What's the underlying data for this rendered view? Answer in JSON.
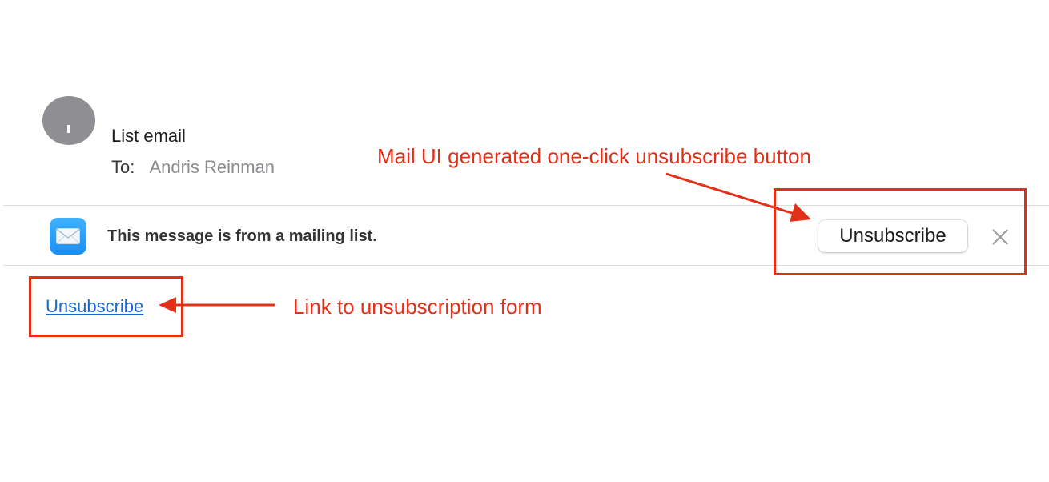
{
  "header": {
    "subject": "List email",
    "to_label": "To:",
    "to_name": "Andris Reinman"
  },
  "banner": {
    "app_icon": "mail-envelope-icon",
    "text": "This message is from a mailing list.",
    "unsubscribe_button": "Unsubscribe",
    "close_icon": "close-icon"
  },
  "body": {
    "unsubscribe_link": "Unsubscribe"
  },
  "annotations": {
    "top": "Mail UI generated one-click unsubscribe button",
    "left": "Link to unsubscription form"
  },
  "colors": {
    "annotation_red": "#e23018",
    "link_blue": "#1a66cc",
    "mail_icon_blue": "#1b8ef2"
  }
}
